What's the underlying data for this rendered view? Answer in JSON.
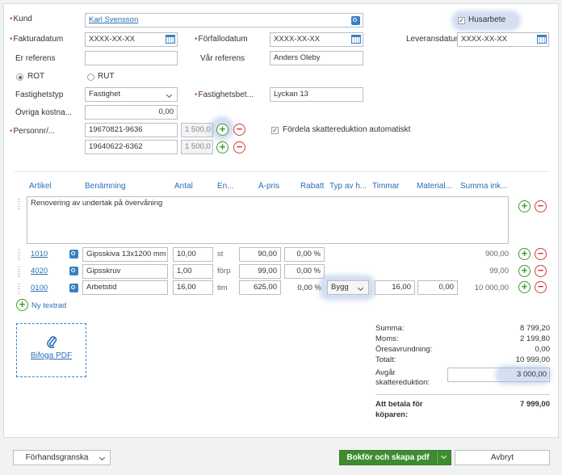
{
  "header": {
    "kund_label": "Kund",
    "kund_value": "Karl Svensson",
    "husarbete_label": "Husarbete",
    "fakturadatum_label": "Fakturadatum",
    "fakturadatum_value": "XXXX-XX-XX",
    "forfallodatum_label": "Förfallodatum",
    "forfallodatum_value": "XXXX-XX-XX",
    "leveransdatum_label": "Leveransdatum",
    "leveransdatum_value": "XXXX-XX-XX",
    "er_referens_label": "Er referens",
    "er_referens_value": "",
    "var_referens_label": "Vår referens",
    "var_referens_value": "Anders Oleby",
    "rot_label": "ROT",
    "rut_label": "RUT",
    "fastighetstyp_label": "Fastighetstyp",
    "fastighetstyp_value": "Fastighet",
    "fastighetsbet_label": "Fastighetsbet...",
    "fastighetsbet_value": "Lyckan 13",
    "ovriga_label": "Övriga kostna...",
    "ovriga_value": "0,00",
    "personnr_label": "Personnr/...",
    "persons": [
      {
        "pnr": "19670821-9636",
        "amount": "1 500,0"
      },
      {
        "pnr": "19640622-6362",
        "amount": "1 500,0"
      }
    ],
    "fordela_label": "Fördela skattereduktion automatiskt"
  },
  "table": {
    "columns": [
      "Artikel",
      "Benämning",
      "Antal",
      "En...",
      "À-pris",
      "Rabatt",
      "Typ av h...",
      "Timmar",
      "Material...",
      "Summa ink..."
    ],
    "text_row": "Renovering av undertak på övervåning",
    "rows": [
      {
        "artikel": "1010",
        "benamning": "Gipsskiva 13x1200 mm",
        "antal": "10,00",
        "enhet": "st",
        "apris": "90,00",
        "rabatt": "0,00 %",
        "typ": "",
        "timmar": "",
        "material": "",
        "summa": "900,00"
      },
      {
        "artikel": "4020",
        "benamning": "Gipsskruv",
        "antal": "1,00",
        "enhet": "förp",
        "apris": "99,00",
        "rabatt": "0,00 %",
        "typ": "",
        "timmar": "",
        "material": "",
        "summa": "99,00"
      },
      {
        "artikel": "0100",
        "benamning": "Arbetstid",
        "antal": "16,00",
        "enhet": "tim",
        "apris": "625,00",
        "rabatt": "0,00 %",
        "typ": "Bygg",
        "timmar": "16,00",
        "material": "0,00",
        "summa": "10 000,00"
      }
    ],
    "new_textrow_label": "Ny textrad"
  },
  "attach": {
    "label": "Bifoga PDF"
  },
  "summary": {
    "summa_label": "Summa:",
    "summa_value": "8 799,20",
    "moms_label": "Moms:",
    "moms_value": "2 199,80",
    "oresavrundning_label": "Öresavrundning:",
    "oresavrundning_value": "0,00",
    "totalt_label": "Totalt:",
    "totalt_value": "10 999,00",
    "avgar_label_1": "Avgår",
    "avgar_label_2": "skattereduktion:",
    "avgar_value": "3 000,00",
    "att_betala_label_1": "Att betala för",
    "att_betala_label_2": "köparen:",
    "att_betala_value": "7 999,00"
  },
  "footer": {
    "preview_label": "Förhandsgranska",
    "book_label": "Bokför och skapa pdf",
    "cancel_label": "Avbryt"
  },
  "colors": {
    "accent": "#2a6fb7",
    "primary_button": "#3d8c2f",
    "add": "#3d9a2f",
    "remove": "#d23c3c"
  }
}
